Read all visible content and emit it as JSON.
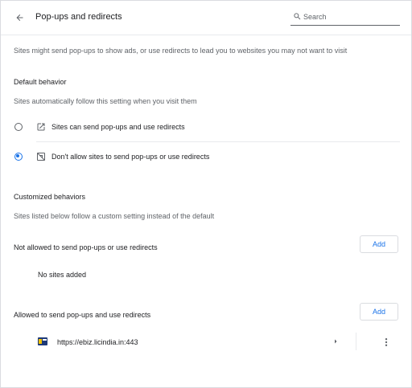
{
  "header": {
    "title": "Pop-ups and redirects",
    "back_icon": "arrow-back-icon",
    "search_placeholder": "Search"
  },
  "intro": "Sites might send pop-ups to show ads, or use redirects to lead you to websites you may not want to visit",
  "default_behavior": {
    "heading": "Default behavior",
    "description": "Sites automatically follow this setting when you visit them",
    "options": [
      {
        "label": "Sites can send pop-ups and use redirects",
        "icon": "open-in-new-icon",
        "selected": false
      },
      {
        "label": "Don't allow sites to send pop-ups or use redirects",
        "icon": "popup-blocked-icon",
        "selected": true
      }
    ]
  },
  "customized": {
    "heading": "Customized behaviors",
    "description": "Sites listed below follow a custom setting instead of the default",
    "not_allowed": {
      "label": "Not allowed to send pop-ups or use redirects",
      "add_label": "Add",
      "empty_text": "No sites added"
    },
    "allowed": {
      "label": "Allowed to send pop-ups and use redirects",
      "add_label": "Add",
      "sites": [
        {
          "url": "https://ebiz.licindia.in:443"
        }
      ]
    }
  },
  "colors": {
    "accent": "#1a73e8",
    "text_primary": "#202124",
    "text_secondary": "#5f6368",
    "divider": "#e8eaed"
  }
}
